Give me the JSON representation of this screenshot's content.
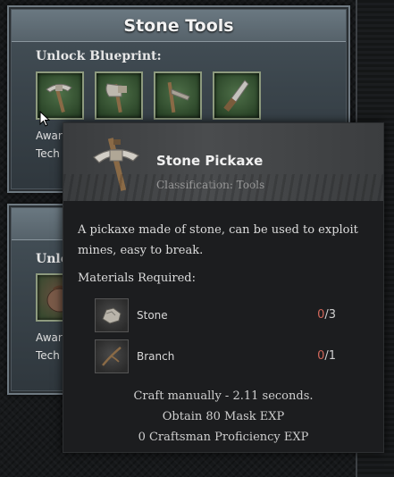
{
  "panel_top": {
    "title": "Stone Tools",
    "unlock_label": "Unlock Blueprint:",
    "award_line1": "Awar",
    "award_line2": "Tech",
    "slots": [
      "pickaxe-icon",
      "axe-icon",
      "hoe-icon",
      "knife-icon"
    ]
  },
  "panel_bottom": {
    "unlock_label": "Unlo",
    "award_line1": "Awar",
    "award_line2": "Tech"
  },
  "tooltip": {
    "name": "Stone Pickaxe",
    "classification": "Classification: Tools",
    "description": "A pickaxe made of stone, can be used to exploit mines, easy to break.",
    "materials_label": "Materials Required:",
    "materials": [
      {
        "name": "Stone",
        "have": "0",
        "need": "/3",
        "icon": "stone-icon"
      },
      {
        "name": "Branch",
        "have": "0",
        "need": "/1",
        "icon": "branch-icon"
      }
    ],
    "footer": [
      "Craft manually - 2.11 seconds.",
      "Obtain 80 Mask EXP",
      "0 Craftsman Proficiency EXP"
    ]
  },
  "colors": {
    "missing_count": "#d0675a",
    "panel_header": "#6a7881",
    "slot_bg": "#2f4a2c"
  }
}
